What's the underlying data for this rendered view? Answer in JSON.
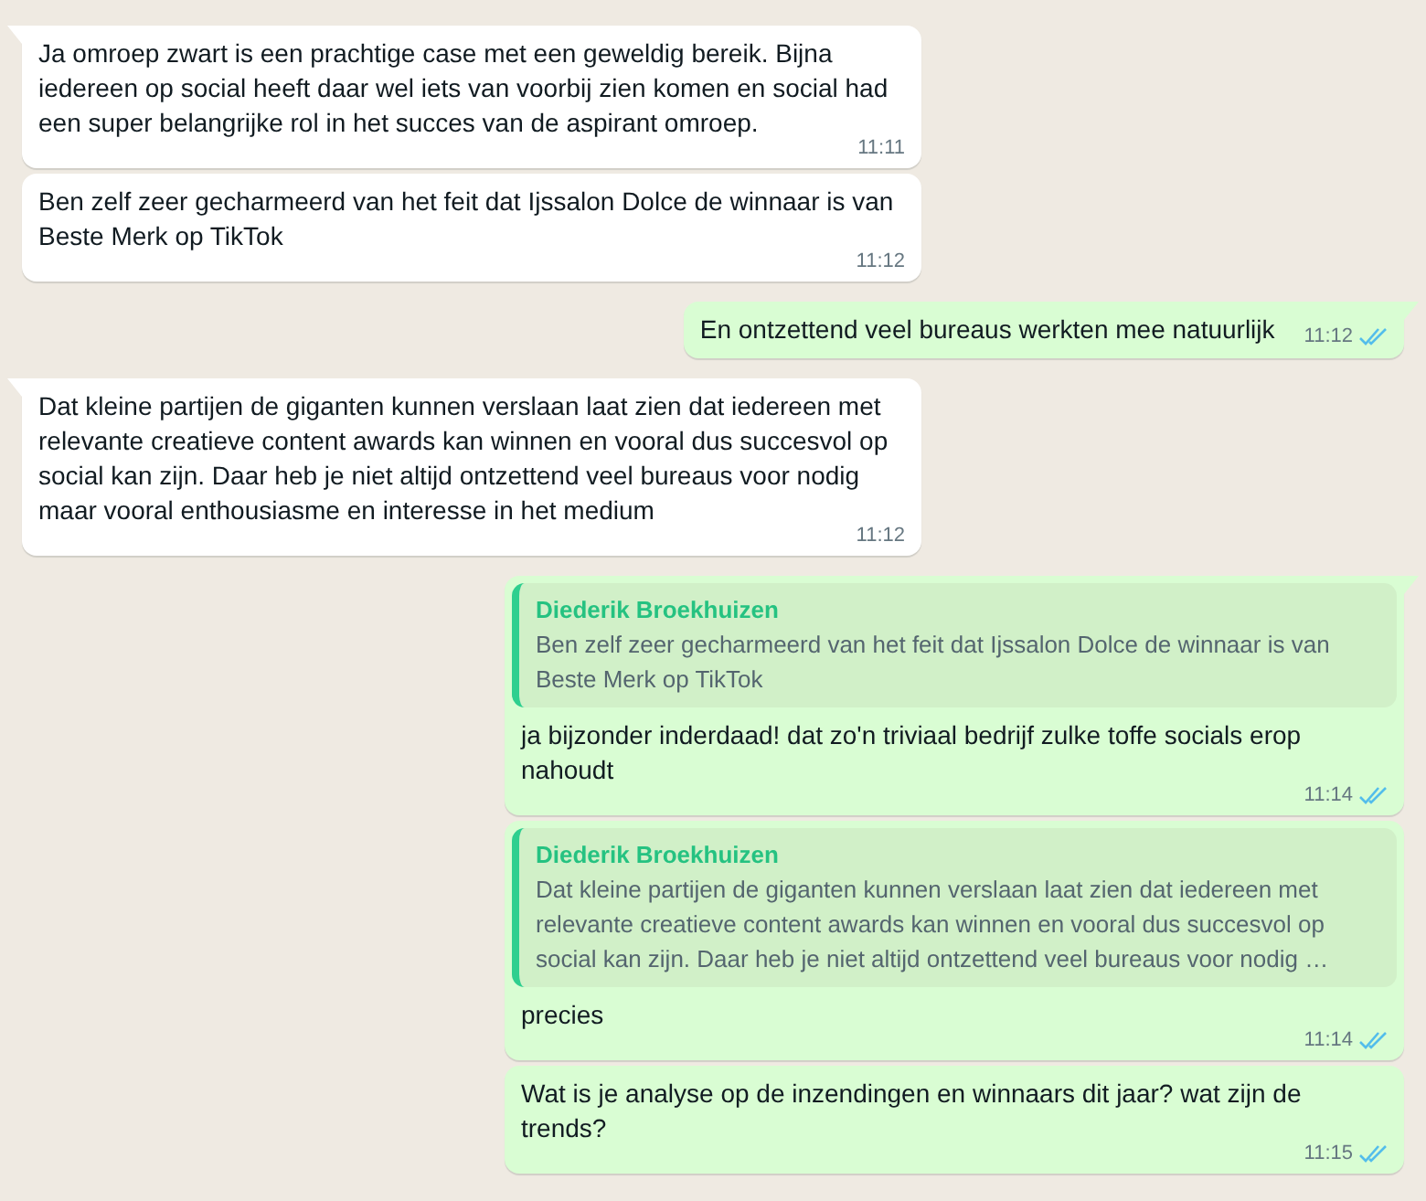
{
  "messages": [
    {
      "kind": "incoming",
      "tail": true,
      "text": "Ja omroep zwart is een prachtige case met een geweldig bereik. Bijna iedereen op social heeft daar wel iets van voorbij zien komen en social had een super belangrijke rol in het succes van de aspirant omroep.",
      "time": "11:11"
    },
    {
      "kind": "incoming",
      "tail": false,
      "text": "Ben zelf zeer gecharmeerd van het feit dat Ijssalon Dolce de winnaar is van Beste Merk op TikTok",
      "time": "11:12"
    },
    {
      "kind": "outgoing",
      "tail": true,
      "text": "En ontzettend veel bureaus werkten mee natuurlijk",
      "time": "11:12",
      "read": true
    },
    {
      "kind": "incoming",
      "tail": true,
      "text": "Dat kleine partijen de giganten kunnen verslaan laat zien dat iedereen met relevante creatieve content awards kan winnen en vooral dus succesvol op social kan zijn. Daar heb je niet altijd ontzettend veel bureaus voor nodig maar vooral enthousiasme en interesse in het medium",
      "time": "11:12"
    },
    {
      "kind": "outgoing",
      "tail": true,
      "quote": {
        "author": "Diederik Broekhuizen",
        "text": "Ben zelf zeer gecharmeerd van het feit dat Ijssalon Dolce de winnaar is van Beste Merk op TikTok"
      },
      "text": "ja bijzonder inderdaad! dat zo'n triviaal bedrijf zulke toffe socials erop nahoudt",
      "time": "11:14",
      "read": true
    },
    {
      "kind": "outgoing",
      "tail": false,
      "quote": {
        "author": "Diederik Broekhuizen",
        "text": "Dat kleine partijen de giganten kunnen verslaan laat zien dat iedereen met relevante creatieve content awards kan winnen en vooral dus succesvol op social kan zijn. Daar heb je niet altijd ontzettend veel bureaus voor nodig …"
      },
      "text": "precies",
      "time": "11:14",
      "read": true
    },
    {
      "kind": "outgoing",
      "tail": false,
      "text": "Wat is je analyse op de inzendingen en winnaars dit jaar? wat zijn de trends?",
      "time": "11:15",
      "read": true
    }
  ]
}
